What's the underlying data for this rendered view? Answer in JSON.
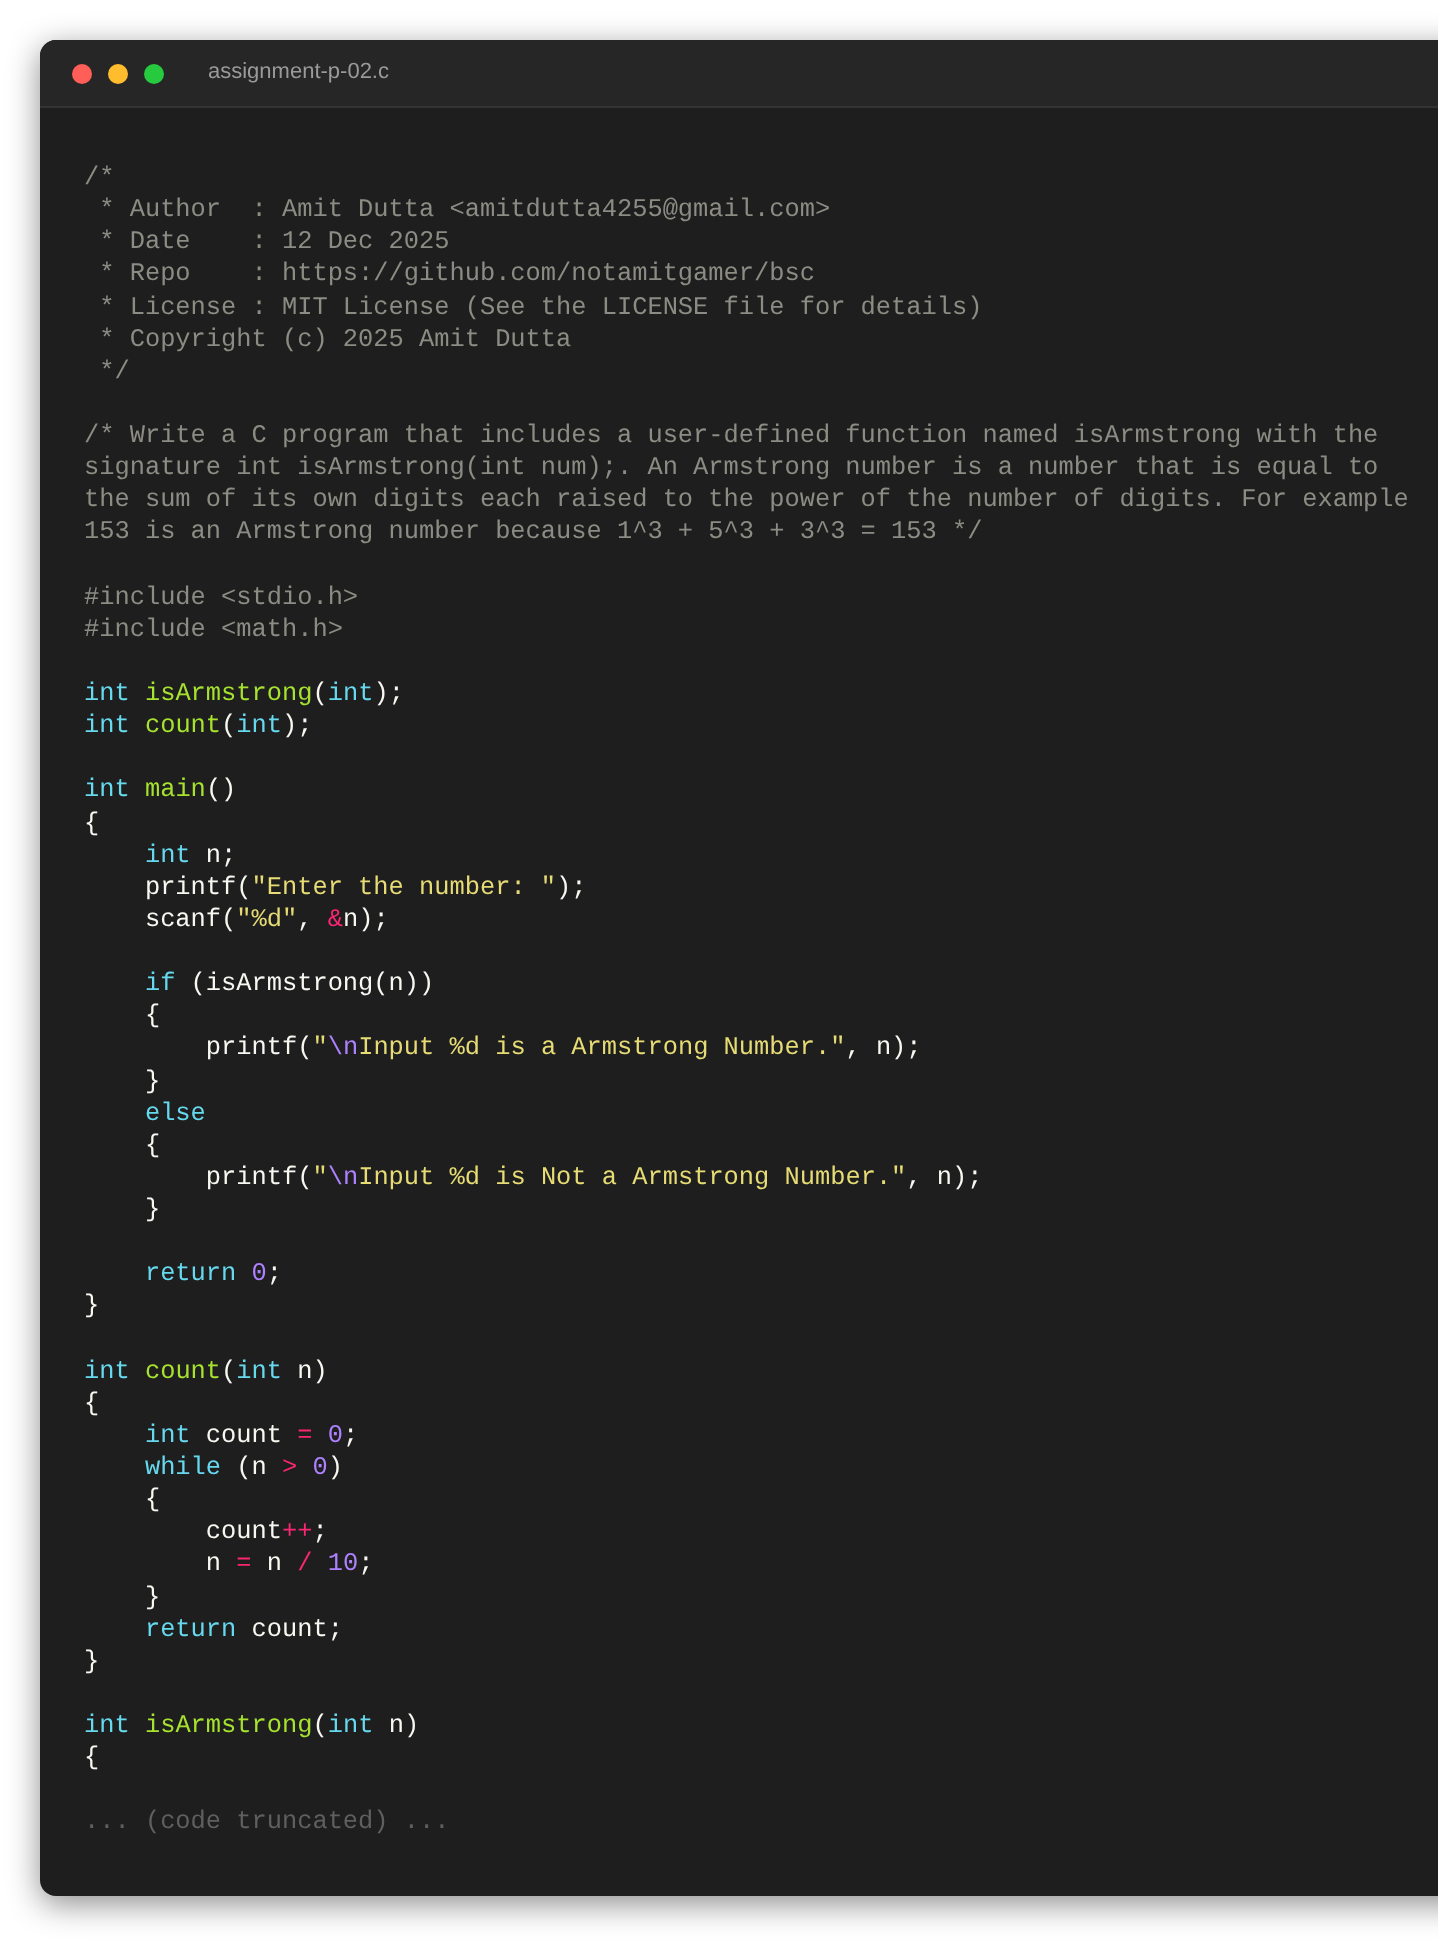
{
  "window": {
    "title": "assignment-p-02.c"
  },
  "code_lines": [
    {
      "kind": "code",
      "tokens": [
        {
          "kind": "comment",
          "text": "/*"
        }
      ]
    },
    {
      "kind": "code",
      "tokens": [
        {
          "kind": "comment",
          "text": " * Author  : Amit Dutta <amitdutta4255@gmail.com>"
        }
      ]
    },
    {
      "kind": "code",
      "tokens": [
        {
          "kind": "comment",
          "text": " * Date    : 12 Dec 2025"
        }
      ]
    },
    {
      "kind": "code",
      "tokens": [
        {
          "kind": "comment",
          "text": " * Repo    : https://github.com/notamitgamer/bsc"
        }
      ]
    },
    {
      "kind": "code",
      "tokens": [
        {
          "kind": "comment",
          "text": " * License : MIT License (See the LICENSE file for details)"
        }
      ]
    },
    {
      "kind": "code",
      "tokens": [
        {
          "kind": "comment",
          "text": " * Copyright (c) 2025 Amit Dutta"
        }
      ]
    },
    {
      "kind": "code",
      "tokens": [
        {
          "kind": "comment",
          "text": " */"
        }
      ]
    },
    {
      "kind": "blank"
    },
    {
      "kind": "code",
      "tokens": [
        {
          "kind": "comment",
          "text": "/* Write a C program that includes a user-defined function named isArmstrong with the"
        }
      ]
    },
    {
      "kind": "code",
      "tokens": [
        {
          "kind": "comment",
          "text": "signature int isArmstrong(int num);. An Armstrong number is a number that is equal to"
        }
      ]
    },
    {
      "kind": "code",
      "tokens": [
        {
          "kind": "comment",
          "text": "the sum of its own digits each raised to the power of the number of digits. For example"
        }
      ]
    },
    {
      "kind": "code",
      "tokens": [
        {
          "kind": "comment",
          "text": "153 is an Armstrong number because 1^3 + 5^3 + 3^3 = 153 */"
        }
      ]
    },
    {
      "kind": "blank"
    },
    {
      "kind": "code",
      "tokens": [
        {
          "kind": "preprocessor",
          "text": "#include <stdio.h>"
        }
      ]
    },
    {
      "kind": "code",
      "tokens": [
        {
          "kind": "preprocessor",
          "text": "#include <math.h>"
        }
      ]
    },
    {
      "kind": "blank"
    },
    {
      "kind": "code",
      "tokens": [
        {
          "kind": "keyword",
          "text": "int "
        },
        {
          "kind": "function",
          "text": "isArmstrong"
        },
        {
          "kind": "plain",
          "text": "("
        },
        {
          "kind": "keyword",
          "text": "int"
        },
        {
          "kind": "plain",
          "text": ");"
        }
      ]
    },
    {
      "kind": "code",
      "tokens": [
        {
          "kind": "keyword",
          "text": "int "
        },
        {
          "kind": "function",
          "text": "count"
        },
        {
          "kind": "plain",
          "text": "("
        },
        {
          "kind": "keyword",
          "text": "int"
        },
        {
          "kind": "plain",
          "text": ");"
        }
      ]
    },
    {
      "kind": "blank"
    },
    {
      "kind": "code",
      "tokens": [
        {
          "kind": "keyword",
          "text": "int "
        },
        {
          "kind": "function",
          "text": "main"
        },
        {
          "kind": "plain",
          "text": "()"
        }
      ]
    },
    {
      "kind": "code",
      "tokens": [
        {
          "kind": "plain",
          "text": "{"
        }
      ]
    },
    {
      "kind": "code",
      "tokens": [
        {
          "kind": "keyword",
          "text": "    int "
        },
        {
          "kind": "plain",
          "text": "n;"
        }
      ]
    },
    {
      "kind": "code",
      "tokens": [
        {
          "kind": "plain",
          "text": "    printf("
        },
        {
          "kind": "string",
          "text": "\"Enter the number: \""
        },
        {
          "kind": "plain",
          "text": ");"
        }
      ]
    },
    {
      "kind": "code",
      "tokens": [
        {
          "kind": "plain",
          "text": "    scanf("
        },
        {
          "kind": "string",
          "text": "\"%d\""
        },
        {
          "kind": "plain",
          "text": ", "
        },
        {
          "kind": "operator",
          "text": "&"
        },
        {
          "kind": "plain",
          "text": "n);"
        }
      ]
    },
    {
      "kind": "blank"
    },
    {
      "kind": "code",
      "tokens": [
        {
          "kind": "keyword",
          "text": "    if "
        },
        {
          "kind": "plain",
          "text": "(isArmstrong(n))"
        }
      ]
    },
    {
      "kind": "code",
      "tokens": [
        {
          "kind": "plain",
          "text": "    {"
        }
      ]
    },
    {
      "kind": "code",
      "tokens": [
        {
          "kind": "plain",
          "text": "        printf("
        },
        {
          "kind": "string",
          "text": "\""
        },
        {
          "kind": "escape",
          "text": "\\n"
        },
        {
          "kind": "string",
          "text": "Input %d is a Armstrong Number.\""
        },
        {
          "kind": "plain",
          "text": ", n);"
        }
      ]
    },
    {
      "kind": "code",
      "tokens": [
        {
          "kind": "plain",
          "text": "    }"
        }
      ]
    },
    {
      "kind": "code",
      "tokens": [
        {
          "kind": "keyword",
          "text": "    else"
        }
      ]
    },
    {
      "kind": "code",
      "tokens": [
        {
          "kind": "plain",
          "text": "    {"
        }
      ]
    },
    {
      "kind": "code",
      "tokens": [
        {
          "kind": "plain",
          "text": "        printf("
        },
        {
          "kind": "string",
          "text": "\""
        },
        {
          "kind": "escape",
          "text": "\\n"
        },
        {
          "kind": "string",
          "text": "Input %d is Not a Armstrong Number.\""
        },
        {
          "kind": "plain",
          "text": ", n);"
        }
      ]
    },
    {
      "kind": "code",
      "tokens": [
        {
          "kind": "plain",
          "text": "    }"
        }
      ]
    },
    {
      "kind": "blank"
    },
    {
      "kind": "code",
      "tokens": [
        {
          "kind": "keyword",
          "text": "    return "
        },
        {
          "kind": "number",
          "text": "0"
        },
        {
          "kind": "plain",
          "text": ";"
        }
      ]
    },
    {
      "kind": "code",
      "tokens": [
        {
          "kind": "plain",
          "text": "}"
        }
      ]
    },
    {
      "kind": "blank"
    },
    {
      "kind": "code",
      "tokens": [
        {
          "kind": "keyword",
          "text": "int "
        },
        {
          "kind": "function",
          "text": "count"
        },
        {
          "kind": "plain",
          "text": "("
        },
        {
          "kind": "keyword",
          "text": "int "
        },
        {
          "kind": "plain",
          "text": "n)"
        }
      ]
    },
    {
      "kind": "code",
      "tokens": [
        {
          "kind": "plain",
          "text": "{"
        }
      ]
    },
    {
      "kind": "code",
      "tokens": [
        {
          "kind": "keyword",
          "text": "    int "
        },
        {
          "kind": "plain",
          "text": "count "
        },
        {
          "kind": "operator",
          "text": "="
        },
        {
          "kind": "number",
          "text": " 0"
        },
        {
          "kind": "plain",
          "text": ";"
        }
      ]
    },
    {
      "kind": "code",
      "tokens": [
        {
          "kind": "keyword",
          "text": "    while "
        },
        {
          "kind": "plain",
          "text": "(n "
        },
        {
          "kind": "operator",
          "text": ">"
        },
        {
          "kind": "number",
          "text": " 0"
        },
        {
          "kind": "plain",
          "text": ")"
        }
      ]
    },
    {
      "kind": "code",
      "tokens": [
        {
          "kind": "plain",
          "text": "    {"
        }
      ]
    },
    {
      "kind": "code",
      "tokens": [
        {
          "kind": "plain",
          "text": "        count"
        },
        {
          "kind": "operator",
          "text": "++"
        },
        {
          "kind": "plain",
          "text": ";"
        }
      ]
    },
    {
      "kind": "code",
      "tokens": [
        {
          "kind": "plain",
          "text": "        n "
        },
        {
          "kind": "operator",
          "text": "="
        },
        {
          "kind": "plain",
          "text": " n "
        },
        {
          "kind": "operator",
          "text": "/"
        },
        {
          "kind": "number",
          "text": " 10"
        },
        {
          "kind": "plain",
          "text": ";"
        }
      ]
    },
    {
      "kind": "code",
      "tokens": [
        {
          "kind": "plain",
          "text": "    }"
        }
      ]
    },
    {
      "kind": "code",
      "tokens": [
        {
          "kind": "keyword",
          "text": "    return "
        },
        {
          "kind": "plain",
          "text": "count;"
        }
      ]
    },
    {
      "kind": "code",
      "tokens": [
        {
          "kind": "plain",
          "text": "}"
        }
      ]
    },
    {
      "kind": "blank"
    },
    {
      "kind": "code",
      "tokens": [
        {
          "kind": "keyword",
          "text": "int "
        },
        {
          "kind": "function",
          "text": "isArmstrong"
        },
        {
          "kind": "plain",
          "text": "("
        },
        {
          "kind": "keyword",
          "text": "int "
        },
        {
          "kind": "plain",
          "text": "n)"
        }
      ]
    },
    {
      "kind": "code",
      "tokens": [
        {
          "kind": "plain",
          "text": "{"
        }
      ]
    },
    {
      "kind": "blank"
    },
    {
      "kind": "code",
      "tokens": [
        {
          "kind": "truncation",
          "text": "... (code truncated) ..."
        }
      ]
    }
  ]
}
